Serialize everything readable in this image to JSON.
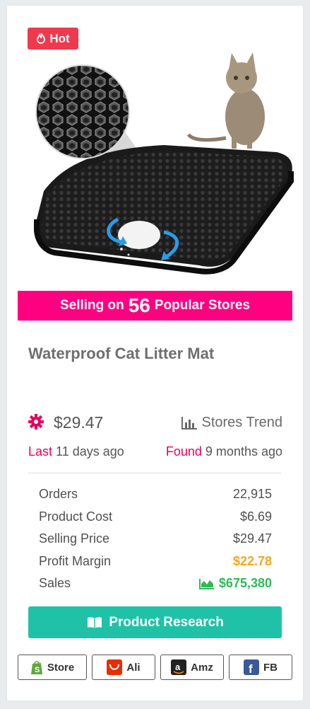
{
  "badge": {
    "label": "Hot"
  },
  "banner": {
    "prefix": "Selling on",
    "count": "56",
    "suffix": "Popular Stores"
  },
  "product": {
    "title": "Waterproof Cat Litter Mat",
    "price": "$29.47"
  },
  "trend": {
    "label": "Stores Trend"
  },
  "dates": {
    "last_label": "Last",
    "last_value": "11 days ago",
    "found_label": "Found",
    "found_value": "9 months ago"
  },
  "stats": [
    {
      "label": "Orders",
      "value": "22,915"
    },
    {
      "label": "Product Cost",
      "value": "$6.69"
    },
    {
      "label": "Selling Price",
      "value": "$29.47"
    },
    {
      "label": "Profit Margin",
      "value": "$22.78"
    },
    {
      "label": "Sales",
      "value": "$675,380"
    }
  ],
  "research_button": {
    "label": "Product Research"
  },
  "links": [
    {
      "label": "Store",
      "icon": "shopify-icon"
    },
    {
      "label": "Ali",
      "icon": "aliexpress-icon"
    },
    {
      "label": "Amz",
      "icon": "amazon-icon"
    },
    {
      "label": "FB",
      "icon": "facebook-icon"
    }
  ],
  "colors": {
    "banner": "#ff0080",
    "hot": "#ef3a4d",
    "accent_pink": "#e8005e",
    "profit": "#f5a623",
    "sales": "#2ebb57",
    "button": "#1fc2a7"
  }
}
